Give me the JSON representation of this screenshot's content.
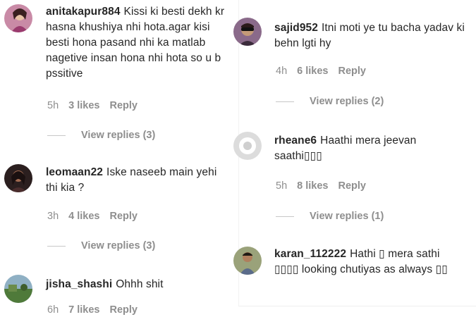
{
  "left": [
    {
      "username": "anitakapur884",
      "text": "Kissi ki besti dekh kr hasna khushiya nhi hota.agar kisi besti hona pasand nhi ka matlab nagetive insan hona nhi hota so u b pssitive",
      "time": "5h",
      "likes": "3 likes",
      "reply": "Reply",
      "view_replies": "View replies (3)",
      "avatar": "avatar-woman-pink"
    },
    {
      "username": "leomaan22",
      "text": "Iske naseeb main yehi thi kia ?",
      "time": "3h",
      "likes": "4 likes",
      "reply": "Reply",
      "view_replies": "View replies (3)",
      "avatar": "avatar-woman-dark"
    },
    {
      "username": "jisha_shashi",
      "text": "Ohhh shit",
      "time": "6h",
      "likes": "7 likes",
      "reply": "Reply",
      "avatar": "avatar-landscape"
    }
  ],
  "right": [
    {
      "username": "sajid952",
      "text": "Itni moti ye tu bacha yadav ki behn lgti hy",
      "time": "4h",
      "likes": "6 likes",
      "reply": "Reply",
      "view_replies": "View replies (2)",
      "avatar": "avatar-man-sunglasses"
    },
    {
      "username": "rheane6",
      "text": "Haathi mera jeevan saathi▯▯▯",
      "time": "5h",
      "likes": "8 likes",
      "reply": "Reply",
      "view_replies": "View replies (1)",
      "avatar": "avatar-default-grey"
    },
    {
      "username": "karan_112222",
      "text": "Hathi ▯ mera sathi ▯▯▯▯ looking chutiyas as always ▯▯",
      "avatar": "avatar-man-outdoor"
    }
  ]
}
